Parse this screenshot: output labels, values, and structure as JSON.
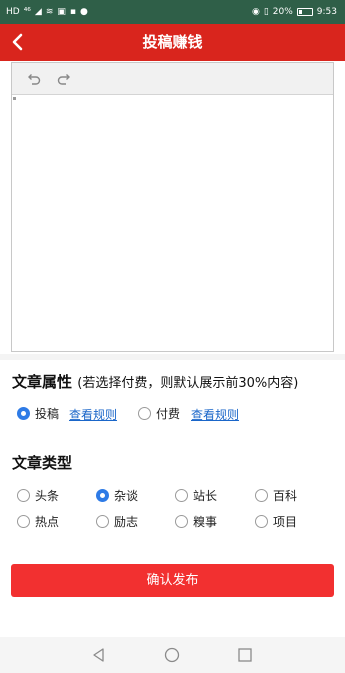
{
  "status_bar": {
    "left_glyphs": [
      "HD",
      "⁴⁶",
      "◢",
      "≋"
    ],
    "right_text": "20%",
    "time": "9:53"
  },
  "header": {
    "title": "投稿赚钱"
  },
  "editor": {
    "undo_icon": "undo-icon",
    "redo_icon": "redo-icon"
  },
  "attributes": {
    "title": "文章属性",
    "note": "(若选择付费，则默认展示前30%内容)",
    "options": [
      {
        "label": "投稿",
        "checked": true,
        "rules_link": "查看规则"
      },
      {
        "label": "付费",
        "checked": false,
        "rules_link": "查看规则"
      }
    ]
  },
  "types": {
    "title": "文章类型",
    "options": [
      {
        "label": "头条",
        "checked": false
      },
      {
        "label": "杂谈",
        "checked": true
      },
      {
        "label": "站长",
        "checked": false
      },
      {
        "label": "百科",
        "checked": false
      },
      {
        "label": "热点",
        "checked": false
      },
      {
        "label": "励志",
        "checked": false
      },
      {
        "label": "糗事",
        "checked": false
      },
      {
        "label": "项目",
        "checked": false
      }
    ]
  },
  "submit": {
    "label": "确认发布"
  },
  "colors": {
    "header": "#d9251d",
    "status_bar": "#2f5f48",
    "accent": "#2e7be6",
    "submit": "#f23030",
    "link": "#1a66c9"
  }
}
